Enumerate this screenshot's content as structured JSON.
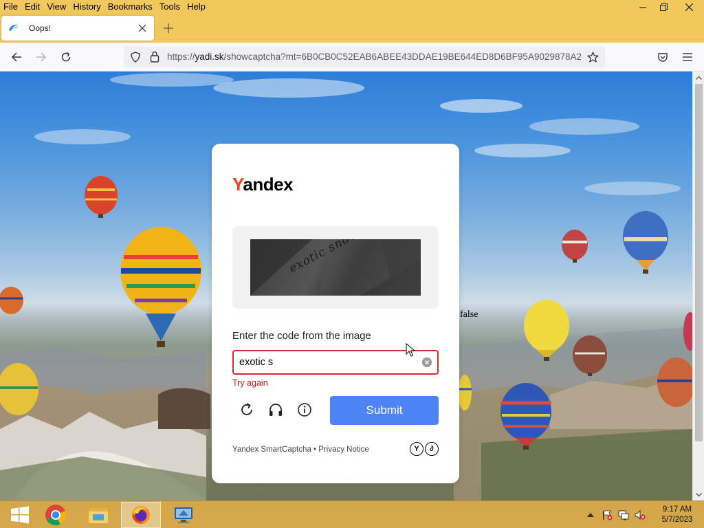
{
  "menubar": {
    "items": [
      "File",
      "Edit",
      "View",
      "History",
      "Bookmarks",
      "Tools",
      "Help"
    ]
  },
  "tab": {
    "title": "Oops!"
  },
  "navbar": {
    "url_prefix": "https://",
    "url_host": "yadi.sk",
    "url_rest": "/showcaptcha?mt=6B0CB0C52EAB6ABEE43DDAE19BE644ED8D6BF95A9029878A2"
  },
  "page": {
    "stray_text": "false"
  },
  "captcha": {
    "logo_first": "Y",
    "logo_rest": "andex",
    "captcha_text": "exotic snowball",
    "prompt": "Enter the code from the image",
    "input_value": "exotic s",
    "error": "Try again",
    "submit_label": "Submit",
    "footer": "Yandex SmartCaptcha • Privacy Notice",
    "badge_letters": [
      "Y",
      "∂"
    ]
  },
  "taskbar": {
    "time": "9:17 AM",
    "date": "5/7/2023"
  },
  "colors": {
    "accent": "#4c84f5",
    "error": "#d62d30",
    "chrome": "#f2c85c",
    "taskbar": "#d4a84a",
    "yandex_red": "#fc3f1d"
  }
}
